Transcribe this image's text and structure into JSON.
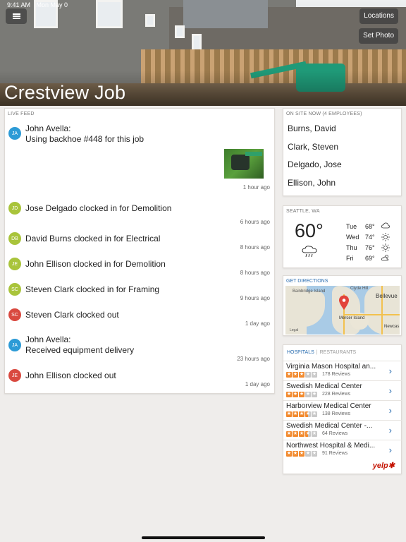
{
  "status_bar": {
    "time": "9:41 AM",
    "date": "Mon May 0"
  },
  "header": {
    "title": "Crestview Job",
    "menu_icon": "hamburger-icon",
    "buttons": {
      "locations": "Locations",
      "set_photo": "Set Photo"
    }
  },
  "live_feed": {
    "label": "LIVE FEED",
    "items": [
      {
        "initials": "JA",
        "color": "#2d9bd6",
        "line1": "John Avella:",
        "line2": "Using backhoe #448 for this job",
        "time": "1 hour ago",
        "has_photo": true
      },
      {
        "initials": "JD",
        "color": "#a9c43b",
        "line1": "Jose Delgado clocked in for Demolition",
        "time": "6 hours ago"
      },
      {
        "initials": "DB",
        "color": "#a9c43b",
        "line1": "David Burns clocked in for Electrical",
        "time": "8 hours ago"
      },
      {
        "initials": "JE",
        "color": "#a9c43b",
        "line1": "John Ellison clocked in for Demolition",
        "time": "8 hours ago"
      },
      {
        "initials": "SC",
        "color": "#a9c43b",
        "line1": "Steven Clark clocked in for Framing",
        "time": "9 hours ago"
      },
      {
        "initials": "SC",
        "color": "#d9493f",
        "line1": "Steven Clark clocked out",
        "time": "1 day ago"
      },
      {
        "initials": "JA",
        "color": "#2d9bd6",
        "line1": "John Avella:",
        "line2": "Received equipment delivery",
        "time": "23 hours ago"
      },
      {
        "initials": "JE",
        "color": "#d9493f",
        "line1": "John Ellison clocked out",
        "time": "1 day ago"
      }
    ]
  },
  "on_site": {
    "label": "ON SITE NOW (4 EMPLOYEES)",
    "employees": [
      "Burns, David",
      "Clark, Steven",
      "Delgado, Jose",
      "Ellison, John"
    ]
  },
  "weather": {
    "location": "SEATTLE, WA",
    "current_temp": "60°",
    "current_icon": "rain-cloud-icon",
    "forecast": [
      {
        "day": "Tue",
        "temp": "68°",
        "icon": "cloud-icon"
      },
      {
        "day": "Wed",
        "temp": "74°",
        "icon": "sun-icon"
      },
      {
        "day": "Thu",
        "temp": "76°",
        "icon": "sun-icon"
      },
      {
        "day": "Fri",
        "temp": "69°",
        "icon": "partly-cloudy-icon"
      }
    ]
  },
  "map": {
    "link": "GET DIRECTIONS",
    "places": [
      "Bainbridge Island",
      "Clyde Hill",
      "Bellevue",
      "Mercer Island",
      "Newcas"
    ],
    "legal": "Legal"
  },
  "yelp": {
    "tabs": {
      "active": "HOSPITALS",
      "other": "RESTAURANTS"
    },
    "businesses": [
      {
        "name": "Virginia Mason Hospital an...",
        "rating": 3,
        "reviews": "178 Reviews"
      },
      {
        "name": "Swedish Medical Center",
        "rating": 3,
        "reviews": "228 Reviews"
      },
      {
        "name": "Harborview Medical Center",
        "rating": 3.5,
        "reviews": "138 Reviews"
      },
      {
        "name": "Swedish Medical Center -...",
        "rating": 3.5,
        "reviews": "64 Reviews"
      },
      {
        "name": "Northwest Hospital & Medi...",
        "rating": 3,
        "reviews": "91 Reviews"
      }
    ],
    "logo": "yelp"
  }
}
